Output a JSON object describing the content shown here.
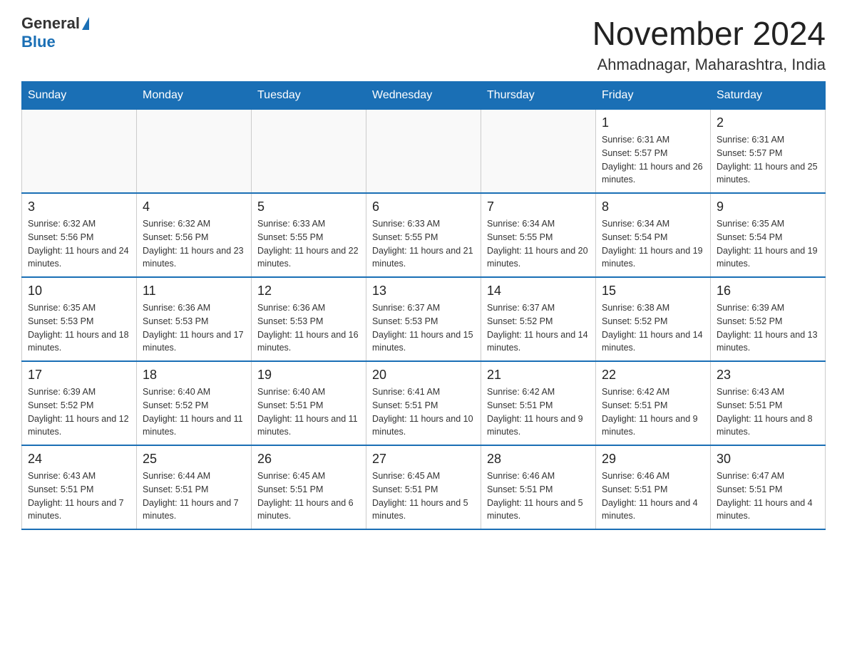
{
  "header": {
    "logo_general": "General",
    "logo_blue": "Blue",
    "month_title": "November 2024",
    "location": "Ahmadnagar, Maharashtra, India"
  },
  "days_of_week": [
    "Sunday",
    "Monday",
    "Tuesday",
    "Wednesday",
    "Thursday",
    "Friday",
    "Saturday"
  ],
  "weeks": [
    [
      {
        "day": "",
        "info": ""
      },
      {
        "day": "",
        "info": ""
      },
      {
        "day": "",
        "info": ""
      },
      {
        "day": "",
        "info": ""
      },
      {
        "day": "",
        "info": ""
      },
      {
        "day": "1",
        "info": "Sunrise: 6:31 AM\nSunset: 5:57 PM\nDaylight: 11 hours and 26 minutes."
      },
      {
        "day": "2",
        "info": "Sunrise: 6:31 AM\nSunset: 5:57 PM\nDaylight: 11 hours and 25 minutes."
      }
    ],
    [
      {
        "day": "3",
        "info": "Sunrise: 6:32 AM\nSunset: 5:56 PM\nDaylight: 11 hours and 24 minutes."
      },
      {
        "day": "4",
        "info": "Sunrise: 6:32 AM\nSunset: 5:56 PM\nDaylight: 11 hours and 23 minutes."
      },
      {
        "day": "5",
        "info": "Sunrise: 6:33 AM\nSunset: 5:55 PM\nDaylight: 11 hours and 22 minutes."
      },
      {
        "day": "6",
        "info": "Sunrise: 6:33 AM\nSunset: 5:55 PM\nDaylight: 11 hours and 21 minutes."
      },
      {
        "day": "7",
        "info": "Sunrise: 6:34 AM\nSunset: 5:55 PM\nDaylight: 11 hours and 20 minutes."
      },
      {
        "day": "8",
        "info": "Sunrise: 6:34 AM\nSunset: 5:54 PM\nDaylight: 11 hours and 19 minutes."
      },
      {
        "day": "9",
        "info": "Sunrise: 6:35 AM\nSunset: 5:54 PM\nDaylight: 11 hours and 19 minutes."
      }
    ],
    [
      {
        "day": "10",
        "info": "Sunrise: 6:35 AM\nSunset: 5:53 PM\nDaylight: 11 hours and 18 minutes."
      },
      {
        "day": "11",
        "info": "Sunrise: 6:36 AM\nSunset: 5:53 PM\nDaylight: 11 hours and 17 minutes."
      },
      {
        "day": "12",
        "info": "Sunrise: 6:36 AM\nSunset: 5:53 PM\nDaylight: 11 hours and 16 minutes."
      },
      {
        "day": "13",
        "info": "Sunrise: 6:37 AM\nSunset: 5:53 PM\nDaylight: 11 hours and 15 minutes."
      },
      {
        "day": "14",
        "info": "Sunrise: 6:37 AM\nSunset: 5:52 PM\nDaylight: 11 hours and 14 minutes."
      },
      {
        "day": "15",
        "info": "Sunrise: 6:38 AM\nSunset: 5:52 PM\nDaylight: 11 hours and 14 minutes."
      },
      {
        "day": "16",
        "info": "Sunrise: 6:39 AM\nSunset: 5:52 PM\nDaylight: 11 hours and 13 minutes."
      }
    ],
    [
      {
        "day": "17",
        "info": "Sunrise: 6:39 AM\nSunset: 5:52 PM\nDaylight: 11 hours and 12 minutes."
      },
      {
        "day": "18",
        "info": "Sunrise: 6:40 AM\nSunset: 5:52 PM\nDaylight: 11 hours and 11 minutes."
      },
      {
        "day": "19",
        "info": "Sunrise: 6:40 AM\nSunset: 5:51 PM\nDaylight: 11 hours and 11 minutes."
      },
      {
        "day": "20",
        "info": "Sunrise: 6:41 AM\nSunset: 5:51 PM\nDaylight: 11 hours and 10 minutes."
      },
      {
        "day": "21",
        "info": "Sunrise: 6:42 AM\nSunset: 5:51 PM\nDaylight: 11 hours and 9 minutes."
      },
      {
        "day": "22",
        "info": "Sunrise: 6:42 AM\nSunset: 5:51 PM\nDaylight: 11 hours and 9 minutes."
      },
      {
        "day": "23",
        "info": "Sunrise: 6:43 AM\nSunset: 5:51 PM\nDaylight: 11 hours and 8 minutes."
      }
    ],
    [
      {
        "day": "24",
        "info": "Sunrise: 6:43 AM\nSunset: 5:51 PM\nDaylight: 11 hours and 7 minutes."
      },
      {
        "day": "25",
        "info": "Sunrise: 6:44 AM\nSunset: 5:51 PM\nDaylight: 11 hours and 7 minutes."
      },
      {
        "day": "26",
        "info": "Sunrise: 6:45 AM\nSunset: 5:51 PM\nDaylight: 11 hours and 6 minutes."
      },
      {
        "day": "27",
        "info": "Sunrise: 6:45 AM\nSunset: 5:51 PM\nDaylight: 11 hours and 5 minutes."
      },
      {
        "day": "28",
        "info": "Sunrise: 6:46 AM\nSunset: 5:51 PM\nDaylight: 11 hours and 5 minutes."
      },
      {
        "day": "29",
        "info": "Sunrise: 6:46 AM\nSunset: 5:51 PM\nDaylight: 11 hours and 4 minutes."
      },
      {
        "day": "30",
        "info": "Sunrise: 6:47 AM\nSunset: 5:51 PM\nDaylight: 11 hours and 4 minutes."
      }
    ]
  ]
}
